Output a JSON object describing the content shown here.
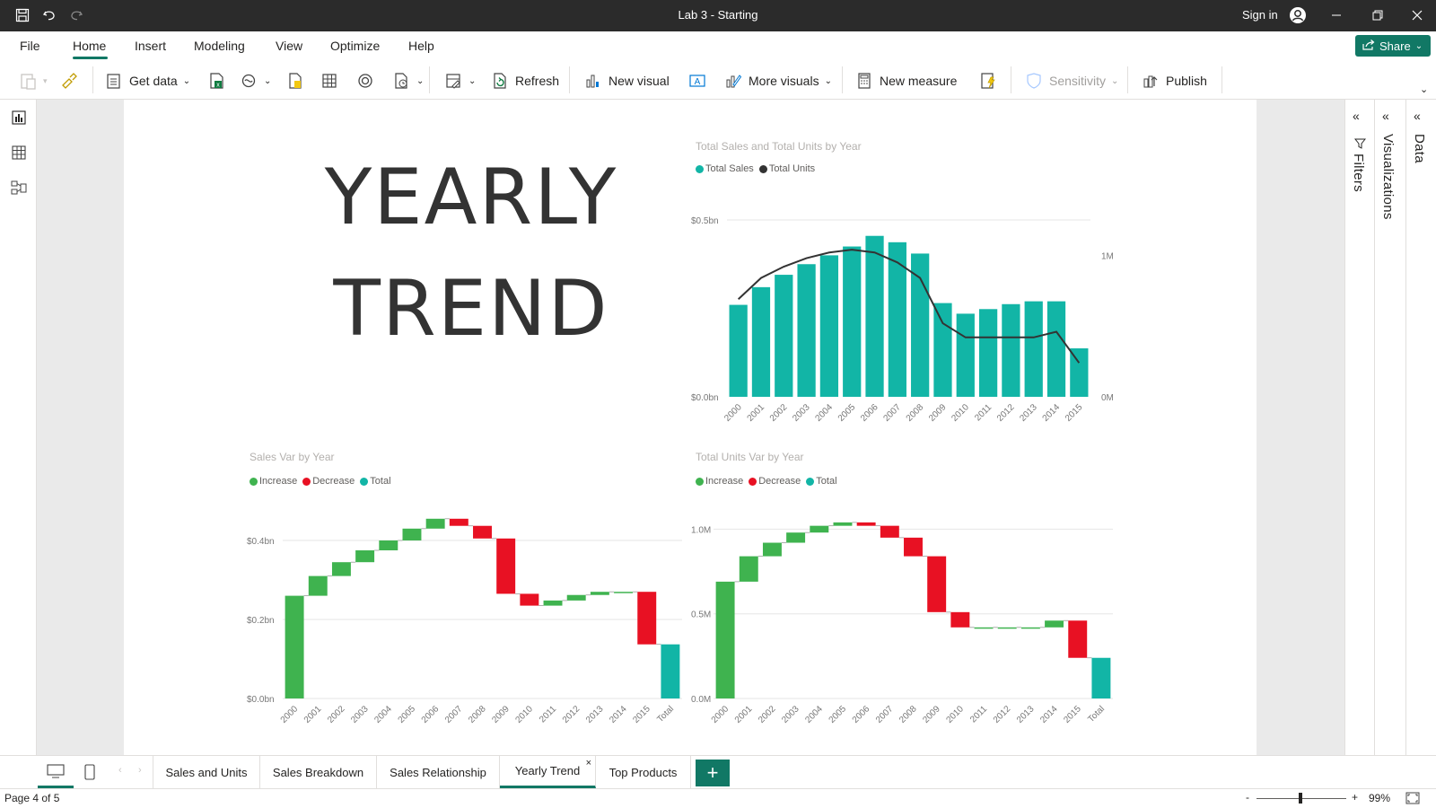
{
  "window": {
    "title": "Lab 3 - Starting",
    "sign_in": "Sign in"
  },
  "menu": {
    "items": [
      "File",
      "Home",
      "Insert",
      "Modeling",
      "View",
      "Optimize",
      "Help"
    ],
    "active": "Home",
    "share": "Share"
  },
  "ribbon": {
    "get_data": "Get data",
    "refresh": "Refresh",
    "new_visual": "New visual",
    "more_visuals": "More visuals",
    "new_measure": "New measure",
    "sensitivity": "Sensitivity",
    "publish": "Publish"
  },
  "side_panes": {
    "filters": "Filters",
    "visualizations": "Visualizations",
    "data": "Data"
  },
  "report": {
    "title_line1": "YEARLY",
    "title_line2": "TREND"
  },
  "pages": [
    "Sales and Units",
    "Sales Breakdown",
    "Sales Relationship",
    "Yearly Trend",
    "Top Products"
  ],
  "active_page": "Yearly Trend",
  "status": {
    "page_indicator": "Page 4 of 5",
    "zoom": "99%",
    "zoom_minus": "-",
    "zoom_plus": "+"
  },
  "colors": {
    "teal": "#12b5a6",
    "green": "#3fb34f",
    "red": "#e81123",
    "dark": "#333333",
    "accent": "#117865"
  },
  "chart_data": [
    {
      "type": "bar",
      "title": "Total Sales and Total Units by Year",
      "legend": [
        "Total Sales",
        "Total Units"
      ],
      "categories": [
        "2000",
        "2001",
        "2002",
        "2003",
        "2004",
        "2005",
        "2006",
        "2007",
        "2008",
        "2009",
        "2010",
        "2011",
        "2012",
        "2013",
        "2014",
        "2015"
      ],
      "series": [
        {
          "name": "Total Sales",
          "kind": "bar",
          "axis": "left",
          "values": [
            0.26,
            0.31,
            0.345,
            0.375,
            0.4,
            0.425,
            0.455,
            0.437,
            0.405,
            0.265,
            0.235,
            0.248,
            0.262,
            0.27,
            0.27,
            0.137
          ]
        },
        {
          "name": "Total Units",
          "kind": "line",
          "axis": "right",
          "values": [
            0.69,
            0.84,
            0.92,
            0.98,
            1.02,
            1.04,
            1.02,
            0.95,
            0.84,
            0.52,
            0.42,
            0.42,
            0.42,
            0.42,
            0.46,
            0.24
          ]
        }
      ],
      "y_left": {
        "ticks": [
          "$0.0bn",
          "$0.5bn"
        ],
        "range": [
          0,
          0.5
        ]
      },
      "y_right": {
        "ticks": [
          "0M",
          "1M"
        ],
        "range": [
          0,
          1.25
        ]
      }
    },
    {
      "type": "waterfall",
      "title": "Sales Var by Year",
      "legend": [
        "Increase",
        "Decrease",
        "Total"
      ],
      "categories": [
        "2000",
        "2001",
        "2002",
        "2003",
        "2004",
        "2005",
        "2006",
        "2007",
        "2008",
        "2009",
        "2010",
        "2011",
        "2012",
        "2013",
        "2014",
        "2015",
        "Total"
      ],
      "deltas": [
        0.26,
        0.05,
        0.035,
        0.03,
        0.025,
        0.03,
        0.025,
        -0.018,
        -0.032,
        -0.14,
        -0.03,
        0.013,
        0.014,
        0.008,
        0.0,
        -0.133
      ],
      "total": 0.137,
      "y": {
        "ticks": [
          "$0.0bn",
          "$0.2bn",
          "$0.4bn"
        ],
        "range": [
          0,
          0.45
        ]
      }
    },
    {
      "type": "waterfall",
      "title": "Total Units Var by Year",
      "legend": [
        "Increase",
        "Decrease",
        "Total"
      ],
      "categories": [
        "2000",
        "2001",
        "2002",
        "2003",
        "2004",
        "2005",
        "2006",
        "2007",
        "2008",
        "2009",
        "2010",
        "2011",
        "2012",
        "2013",
        "2014",
        "2015",
        "Total"
      ],
      "deltas": [
        0.69,
        0.15,
        0.08,
        0.06,
        0.04,
        0.02,
        -0.02,
        -0.07,
        -0.11,
        -0.33,
        -0.09,
        0.0,
        0.0,
        0.0,
        0.04,
        -0.22
      ],
      "total": 0.24,
      "y": {
        "ticks": [
          "0.0M",
          "0.5M",
          "1.0M"
        ],
        "range": [
          0,
          1.05
        ]
      }
    }
  ]
}
